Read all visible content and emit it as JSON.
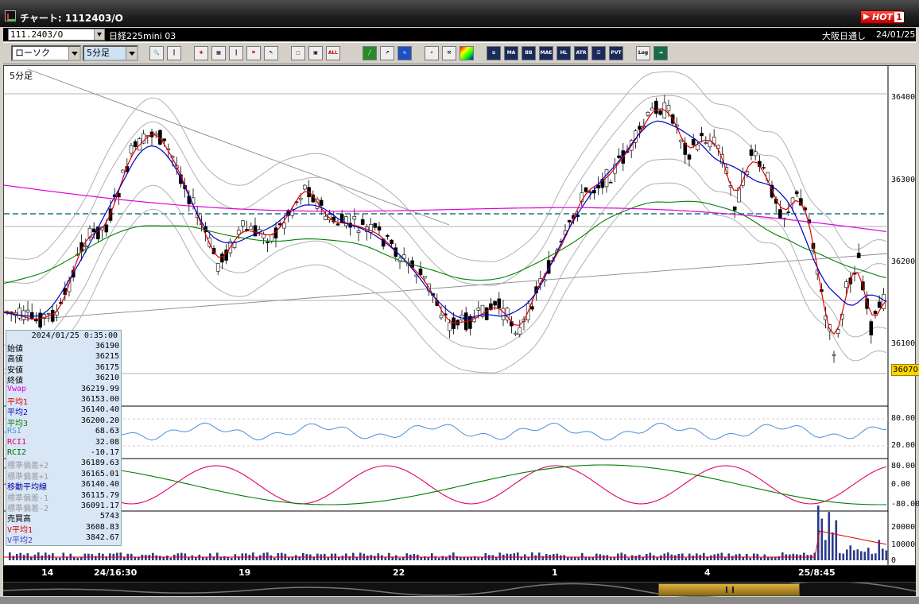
{
  "window": {
    "title": "チャート: 1112403/O",
    "hot_label": "HOT",
    "hot_number": "1"
  },
  "infobar": {
    "symbol_code": "111.2403/O",
    "symbol_name": "日経225mini 03",
    "session": "大阪日通し",
    "date": "24/01/25"
  },
  "toolbar": {
    "chart_type": "ローソク",
    "period": "5分足",
    "buttons": [
      "zoom",
      "window-split",
      "crosshair",
      "grid",
      "bar",
      "flag",
      "cursor",
      "frame",
      "range",
      "all",
      "draw-line",
      "arrow",
      "wave",
      "target",
      "tools",
      "palette",
      "ichimoku",
      "MA",
      "BB",
      "MAE",
      "HL",
      "ATR",
      "RSI",
      "PVT",
      "log",
      "export"
    ],
    "labels": {
      "all": "ALL",
      "ma": "MA",
      "bb": "BB",
      "mae": "MAE",
      "hl": "HL",
      "atr": "ATR",
      "pvt": "PVT",
      "log": "Log"
    }
  },
  "chart": {
    "timeframe_label": "5分足",
    "last_price_tag": "36070"
  },
  "y_axis": {
    "price": [
      "36400",
      "36300",
      "36200",
      "36100"
    ],
    "rsi": [
      "80.00",
      "20.00"
    ],
    "rci": [
      "80.00",
      "0.00",
      "-80.00"
    ],
    "volume": [
      "20000",
      "10000",
      "0"
    ]
  },
  "x_axis": {
    "labels": [
      "14",
      "24/16:30",
      "19",
      "22",
      "1",
      "4",
      "25/8:45"
    ]
  },
  "data_panel": {
    "datetime": "2024/01/25  0:35:00",
    "rows": [
      {
        "label": "始値",
        "value": "36190",
        "color": "#000000"
      },
      {
        "label": "高値",
        "value": "36215",
        "color": "#000000"
      },
      {
        "label": "安値",
        "value": "36175",
        "color": "#000000"
      },
      {
        "label": "終値",
        "value": "36210",
        "color": "#000000"
      },
      {
        "label": "Vwap",
        "value": "36219.99",
        "color": "#e000e0"
      },
      {
        "label": "平均1",
        "value": "36153.00",
        "color": "#e00000"
      },
      {
        "label": "平均2",
        "value": "36140.40",
        "color": "#0000c0"
      },
      {
        "label": "平均3",
        "value": "36200.20",
        "color": "#008000"
      },
      {
        "label": "RSI",
        "value": "68.63",
        "color": "#4a90d9"
      },
      {
        "label": "RCI1",
        "value": "32.08",
        "color": "#e0006a"
      },
      {
        "label": "RCI2",
        "value": "-10.17",
        "color": "#007000"
      },
      {
        "label": "標準偏差+2",
        "value": "36189.63",
        "color": "#9a9a9a"
      },
      {
        "label": "標準偏差+1",
        "value": "36165.01",
        "color": "#9a9a9a"
      },
      {
        "label": "移動平均線",
        "value": "36140.40",
        "color": "#0000a0"
      },
      {
        "label": "標準偏差-1",
        "value": "36115.79",
        "color": "#9a9a9a"
      },
      {
        "label": "標準偏差-2",
        "value": "36091.17",
        "color": "#9a9a9a"
      },
      {
        "label": "売買高",
        "value": "5743",
        "color": "#000000"
      },
      {
        "label": "V平均1",
        "value": "3608.83",
        "color": "#e00000"
      },
      {
        "label": "V平均2",
        "value": "3842.67",
        "color": "#4040c0"
      }
    ]
  },
  "colors": {
    "candle_up": "#ffffff",
    "candle_down": "#000000",
    "ma1": "#e00000",
    "ma2": "#0000c0",
    "ma3": "#008000",
    "vwap": "#e000e0",
    "bands": "#b0b0b0",
    "rsi": "#4a90d9",
    "rci1": "#e0006a",
    "rci2": "#008000",
    "dashed_level": "#207080"
  }
}
